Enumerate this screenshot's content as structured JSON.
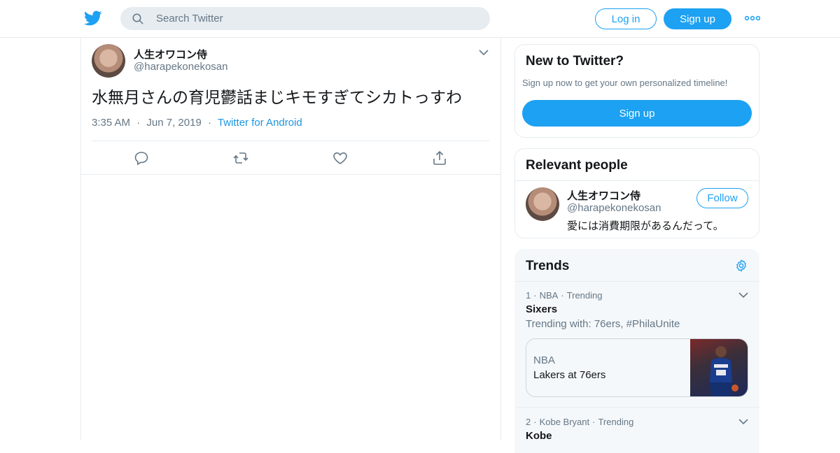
{
  "header": {
    "search_placeholder": "Search Twitter",
    "login_label": "Log in",
    "signup_label": "Sign up",
    "brand_color": "#1da1f2"
  },
  "tweet": {
    "display_name": "人生オワコン侍",
    "handle": "@harapekonekosan",
    "text": "水無月さんの育児鬱話まじキモすぎてシカトっすわ",
    "time": "3:35 AM",
    "date": "Jun 7, 2019",
    "source": "Twitter for Android",
    "meta_separator": "·",
    "icons": [
      "reply-icon",
      "retweet-icon",
      "like-icon",
      "share-icon"
    ]
  },
  "sidebar": {
    "new_to_twitter": {
      "title": "New to Twitter?",
      "subtitle": "Sign up now to get your own personalized timeline!",
      "button": "Sign up"
    },
    "relevant_people": {
      "title": "Relevant people",
      "name": "人生オワコン侍",
      "handle": "@harapekonekosan",
      "bio": "愛には消費期限があるんだって。",
      "follow_label": "Follow"
    },
    "trends": {
      "title": "Trends",
      "items": [
        {
          "rank": "1",
          "category": "NBA",
          "status": "Trending",
          "name": "Sixers",
          "trending_with": "Trending with: 76ers, #PhilaUnite",
          "news": {
            "category": "NBA",
            "headline": "Lakers at 76ers"
          }
        },
        {
          "rank": "2",
          "category": "Kobe Bryant",
          "status": "Trending",
          "name": "Kobe"
        }
      ]
    }
  }
}
